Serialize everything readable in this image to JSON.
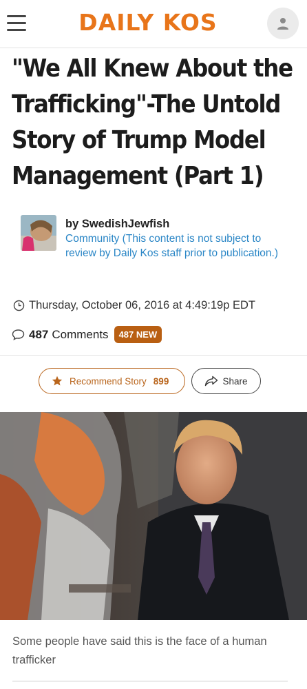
{
  "header": {
    "logo_text": "DAILY KOS",
    "menu_icon": "hamburger-icon",
    "account_icon": "user-icon",
    "logo_color": "#e8751a"
  },
  "article": {
    "title": "\"We All Knew About the Trafficking\"-The Untold Story of Trump Model Management (Part 1)",
    "byline": "by SwedishJewfish",
    "community_note": "Community (This content is not subject to review by Daily Kos staff prior to publication.)",
    "date": "Thursday, October 06, 2016 at 4:49:19p EDT",
    "comments_count": "487",
    "comments_label": "Comments",
    "new_badge": "487 NEW",
    "recommend_label": "Recommend Story",
    "recommend_count": "899",
    "share_label": "Share",
    "caption": "Some people have said this is the face of a human trafficker"
  },
  "colors": {
    "accent": "#b9651c",
    "link": "#2a86c6",
    "badge": "#b95f12"
  }
}
